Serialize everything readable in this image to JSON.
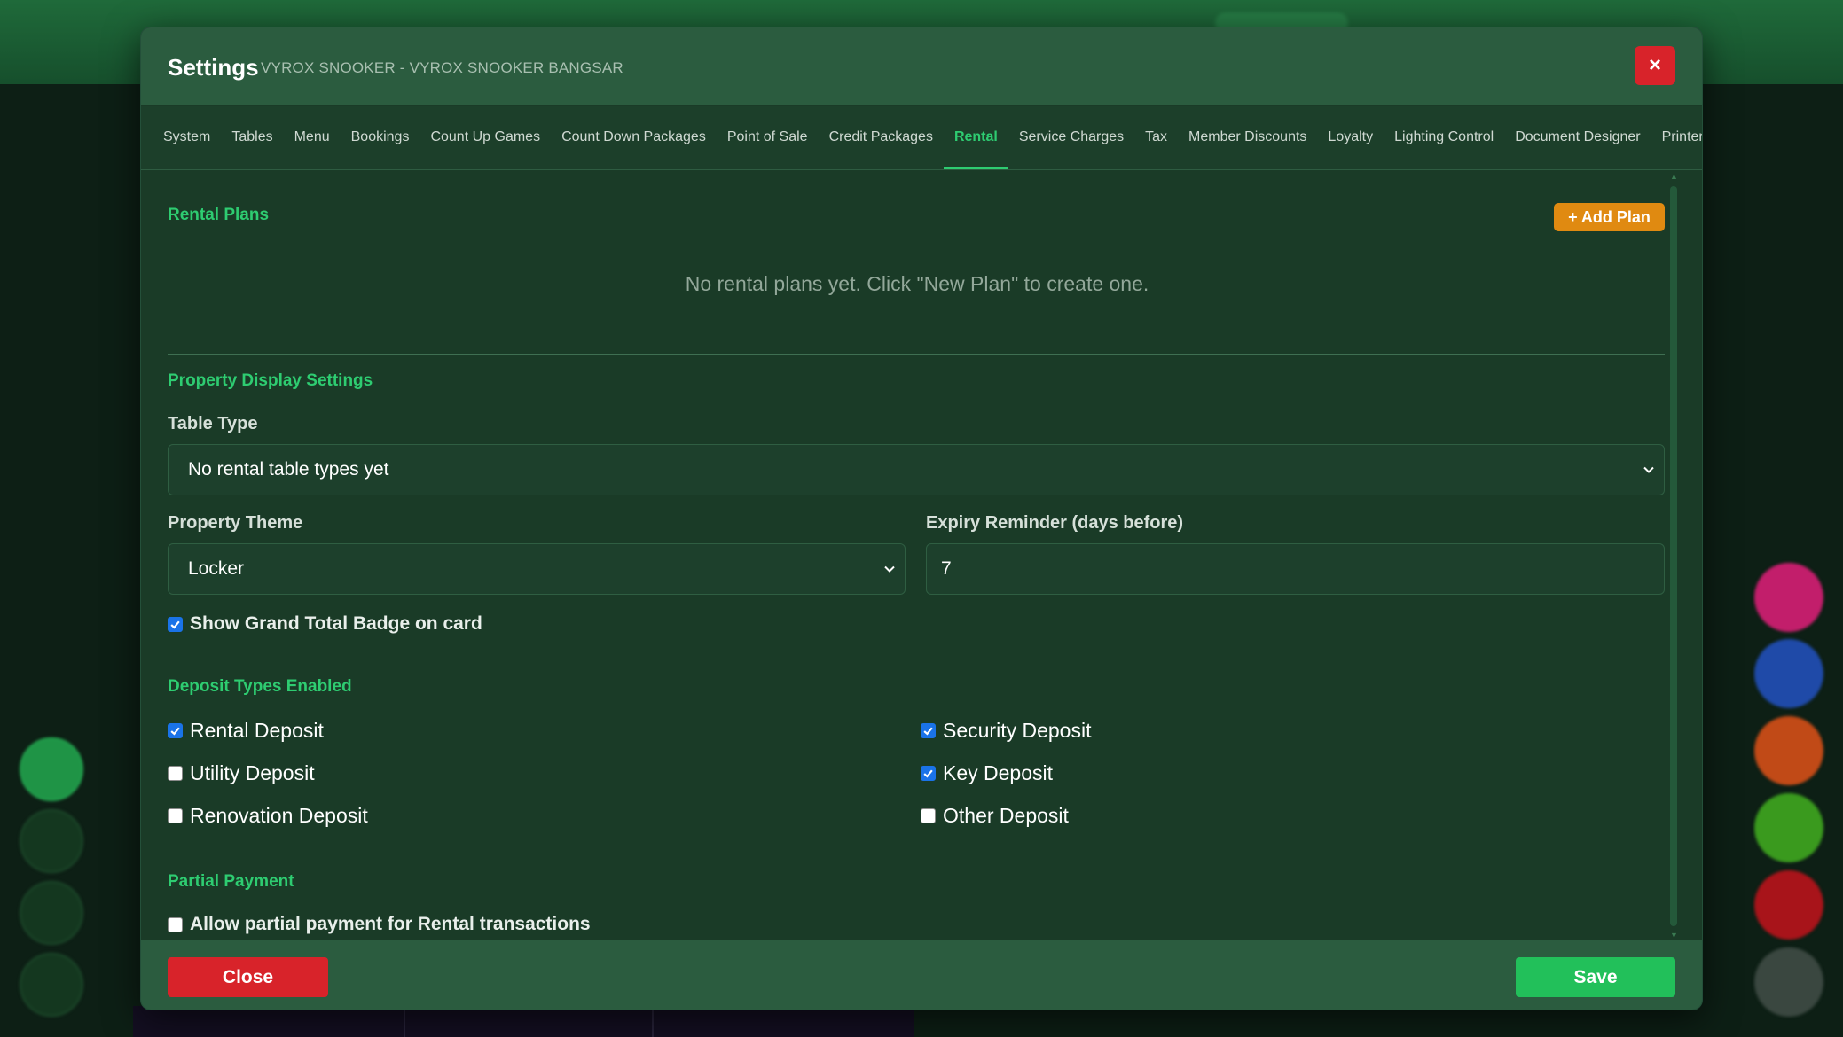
{
  "modal": {
    "title": "Settings",
    "subtitle": "VYROX SNOOKER - VYROX SNOOKER BANGSAR",
    "close_icon": "×"
  },
  "tabs": [
    {
      "label": "System"
    },
    {
      "label": "Tables"
    },
    {
      "label": "Menu"
    },
    {
      "label": "Bookings"
    },
    {
      "label": "Count Up Games"
    },
    {
      "label": "Count Down Packages"
    },
    {
      "label": "Point of Sale"
    },
    {
      "label": "Credit Packages"
    },
    {
      "label": "Rental",
      "active": true
    },
    {
      "label": "Service Charges"
    },
    {
      "label": "Tax"
    },
    {
      "label": "Member Discounts"
    },
    {
      "label": "Loyalty"
    },
    {
      "label": "Lighting Control"
    },
    {
      "label": "Document Designer"
    },
    {
      "label": "Printers"
    }
  ],
  "rental_plans": {
    "title": "Rental Plans",
    "add_button": "+ Add Plan",
    "empty_message": "No rental plans yet. Click \"New Plan\" to create one."
  },
  "property_display": {
    "title": "Property Display Settings",
    "table_type_label": "Table Type",
    "table_type_value": "No rental table types yet",
    "property_theme_label": "Property Theme",
    "property_theme_value": "Locker",
    "expiry_label": "Expiry Reminder (days before)",
    "expiry_value": "7",
    "grand_total_label": "Show Grand Total Badge on card",
    "grand_total_checked": true
  },
  "deposit_types": {
    "title": "Deposit Types Enabled",
    "items": [
      {
        "label": "Rental Deposit",
        "checked": true
      },
      {
        "label": "Security Deposit",
        "checked": true
      },
      {
        "label": "Utility Deposit",
        "checked": false
      },
      {
        "label": "Key Deposit",
        "checked": true
      },
      {
        "label": "Renovation Deposit",
        "checked": false
      },
      {
        "label": "Other Deposit",
        "checked": false
      }
    ]
  },
  "partial_payment": {
    "title": "Partial Payment",
    "label": "Allow partial payment for Rental transactions",
    "checked": false
  },
  "footer": {
    "close_label": "Close",
    "save_label": "Save"
  },
  "colors": {
    "accent_green": "#2ecc71",
    "danger_red": "#d8232a",
    "add_orange": "#e08a11",
    "save_green": "#22c05a",
    "checkbox_blue": "#1a73e8"
  }
}
